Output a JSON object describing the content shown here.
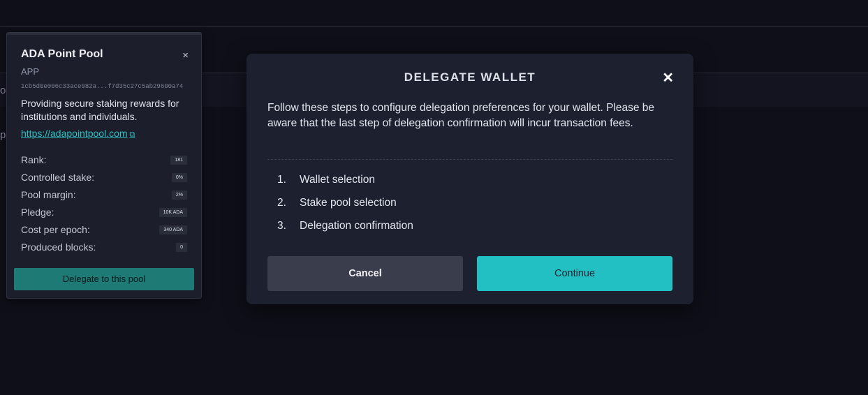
{
  "background": {
    "frag_a": "o",
    "frag_b": "p"
  },
  "pool": {
    "name": "ADA Point Pool",
    "ticker": "APP",
    "id": "1cb5d0e006c33ace982a...f7d35c27c5ab29600a74",
    "description": "Providing secure staking rewards for institutions and individuals.",
    "url": "https://adapointpool.com",
    "stats": [
      {
        "label": "Rank:",
        "value": "181"
      },
      {
        "label": "Controlled stake:",
        "value": "0%"
      },
      {
        "label": "Pool margin:",
        "value": "2%"
      },
      {
        "label": "Pledge:",
        "value": "10K ADA"
      },
      {
        "label": "Cost per epoch:",
        "value": "340 ADA"
      },
      {
        "label": "Produced blocks:",
        "value": "0"
      }
    ],
    "delegate_label": "Delegate to this pool",
    "close_glyph": "×"
  },
  "modal": {
    "title": "DELEGATE WALLET",
    "close_glyph": "✕",
    "intro": "Follow these steps to configure delegation preferences for your wallet. Please be aware that the last step of delegation confirmation will incur transaction fees.",
    "steps": [
      {
        "num": "1.",
        "label": "Wallet selection"
      },
      {
        "num": "2.",
        "label": "Stake pool selection"
      },
      {
        "num": "3.",
        "label": "Delegation confirmation"
      }
    ],
    "cancel_label": "Cancel",
    "continue_label": "Continue"
  },
  "colors": {
    "accent": "#22c0c2",
    "delegate_button": "#1d7a75",
    "modal_bg": "#1d202e",
    "page_bg": "#0f0f19"
  }
}
